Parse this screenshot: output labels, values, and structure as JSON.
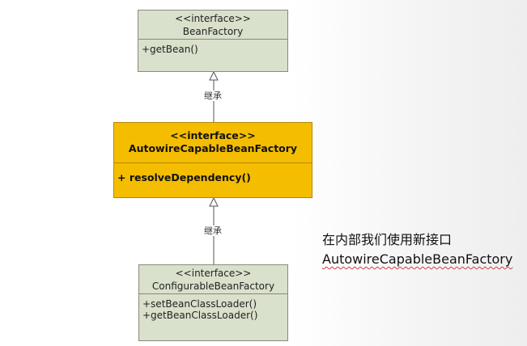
{
  "diagram": {
    "bean_factory": {
      "stereotype": "<<interface>>",
      "name": "BeanFactory",
      "methods": [
        "+getBean()"
      ]
    },
    "autowire_capable": {
      "stereotype": "<<interface>>",
      "name": "AutowireCapableBeanFactory",
      "methods": [
        "+ resolveDependency()"
      ],
      "highlight_color": "#f5bd00"
    },
    "configurable": {
      "stereotype": "<<interface>>",
      "name": "ConfigurableBeanFactory",
      "methods": [
        "+setBeanClassLoader()",
        "+getBeanClassLoader()"
      ]
    },
    "relations": [
      {
        "label": "继承",
        "from": "AutowireCapableBeanFactory",
        "to": "BeanFactory"
      },
      {
        "label": "继承",
        "from": "ConfigurableBeanFactory",
        "to": "AutowireCapableBeanFactory"
      }
    ],
    "box_color": "#d9e0cb"
  },
  "callout": {
    "line1": "在内部我们使用新接口",
    "line2": "AutowireCapableBeanFactory"
  }
}
